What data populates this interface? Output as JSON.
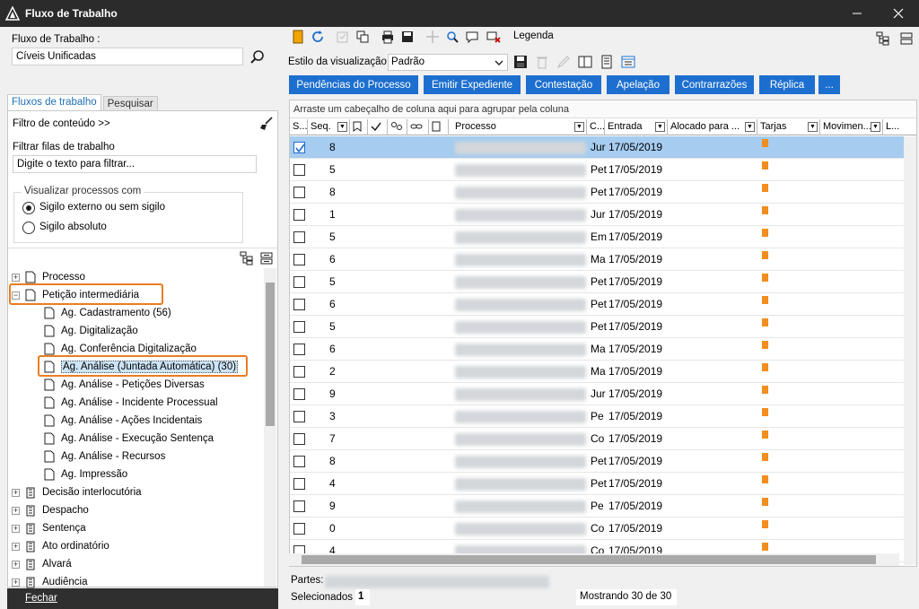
{
  "window": {
    "title": "Fluxo de Trabalho"
  },
  "left": {
    "fluxo_label": "Fluxo de Trabalho :",
    "fluxo_value": "Cíveis Unificadas",
    "tabs": [
      {
        "label": "Fluxos de trabalho"
      },
      {
        "label": "Pesquisar"
      }
    ],
    "filtro_conteudo": "Filtro de conteúdo >>",
    "filtrar_label": "Filtrar filas de trabalho",
    "filtrar_placeholder": "Digite o texto para filtrar...",
    "visualizar_title": "Visualizar processos com",
    "radio1": "Sigilo externo ou sem sigilo",
    "radio2": "Sigilo absoluto",
    "tree": [
      {
        "label": "Processo"
      },
      {
        "label": "Petição intermediária"
      },
      {
        "label": "Ag. Cadastramento (56)"
      },
      {
        "label": "Ag. Digitalização"
      },
      {
        "label": "Ag. Conferência Digitalização"
      },
      {
        "label": "Ag. Análise (Juntada Automática) (30)"
      },
      {
        "label": "Ag. Análise - Petições Diversas"
      },
      {
        "label": "Ag. Análise - Incidente Processual"
      },
      {
        "label": "Ag. Análise - Ações Incidentais"
      },
      {
        "label": "Ag. Análise - Execução Sentença"
      },
      {
        "label": "Ag. Análise - Recursos"
      },
      {
        "label": "Ag. Impressão"
      },
      {
        "label": "Decisão interlocutória"
      },
      {
        "label": "Despacho"
      },
      {
        "label": "Sentença"
      },
      {
        "label": "Ato ordinatório"
      },
      {
        "label": "Alvará"
      },
      {
        "label": "Audiência"
      }
    ],
    "fechar": "Fechar"
  },
  "right": {
    "legenda": "Legenda",
    "estilo_label": "Estilo da visualização",
    "estilo_value": "Padrão",
    "buttons": [
      {
        "label": "Pendências do Processo"
      },
      {
        "label": "Emitir Expediente"
      },
      {
        "label": "Contestação"
      },
      {
        "label": "Apelação"
      },
      {
        "label": "Contrarrazões"
      },
      {
        "label": "Réplica"
      },
      {
        "label": "..."
      }
    ],
    "group_hint": "Arraste um cabeçalho de coluna aqui para agrupar pela coluna",
    "columns": {
      "s": "S...",
      "seq": "Seq.",
      "processo": "Processo",
      "c": "C...",
      "entrada": "Entrada",
      "alocado": "Alocado para ...",
      "tarjas": "Tarjas",
      "movimento": "Movimen...",
      "l": "L..."
    },
    "rows": [
      {
        "seq": "8",
        "c": "Jur",
        "entrada": "17/05/2019",
        "checked": true
      },
      {
        "seq": "5",
        "c": "Pet",
        "entrada": "17/05/2019"
      },
      {
        "seq": "8",
        "c": "Pet",
        "entrada": "17/05/2019"
      },
      {
        "seq": "1",
        "c": "Jur",
        "entrada": "17/05/2019"
      },
      {
        "seq": "5",
        "c": "Em",
        "entrada": "17/05/2019"
      },
      {
        "seq": "6",
        "c": "Ma",
        "entrada": "17/05/2019"
      },
      {
        "seq": "5",
        "c": "Pet",
        "entrada": "17/05/2019"
      },
      {
        "seq": "6",
        "c": "Pet",
        "entrada": "17/05/2019"
      },
      {
        "seq": "5",
        "c": "Pet",
        "entrada": "17/05/2019"
      },
      {
        "seq": "6",
        "c": "Ma",
        "entrada": "17/05/2019"
      },
      {
        "seq": "2",
        "c": "Ma",
        "entrada": "17/05/2019"
      },
      {
        "seq": "9",
        "c": "Jur",
        "entrada": "17/05/2019"
      },
      {
        "seq": "3",
        "c": "Pe",
        "entrada": "17/05/2019"
      },
      {
        "seq": "7",
        "c": "Co",
        "entrada": "17/05/2019"
      },
      {
        "seq": "8",
        "c": "Pet",
        "entrada": "17/05/2019"
      },
      {
        "seq": "4",
        "c": "Pet",
        "entrada": "17/05/2019"
      },
      {
        "seq": "9",
        "c": "Pe",
        "entrada": "17/05/2019"
      },
      {
        "seq": "0",
        "c": "Co",
        "entrada": "17/05/2019"
      },
      {
        "seq": "4",
        "c": "Co",
        "entrada": "17/05/2019"
      }
    ],
    "partes_label": "Partes:",
    "selecionados_label": "Selecionados",
    "selecionados_value": "1",
    "mostrando": "Mostrando 30 de 30"
  },
  "colors": {
    "accent": "#1d6fcf",
    "tarja": "#f28d1f",
    "highlight": "#e97d22",
    "titlebar": "#2b2b2b"
  }
}
